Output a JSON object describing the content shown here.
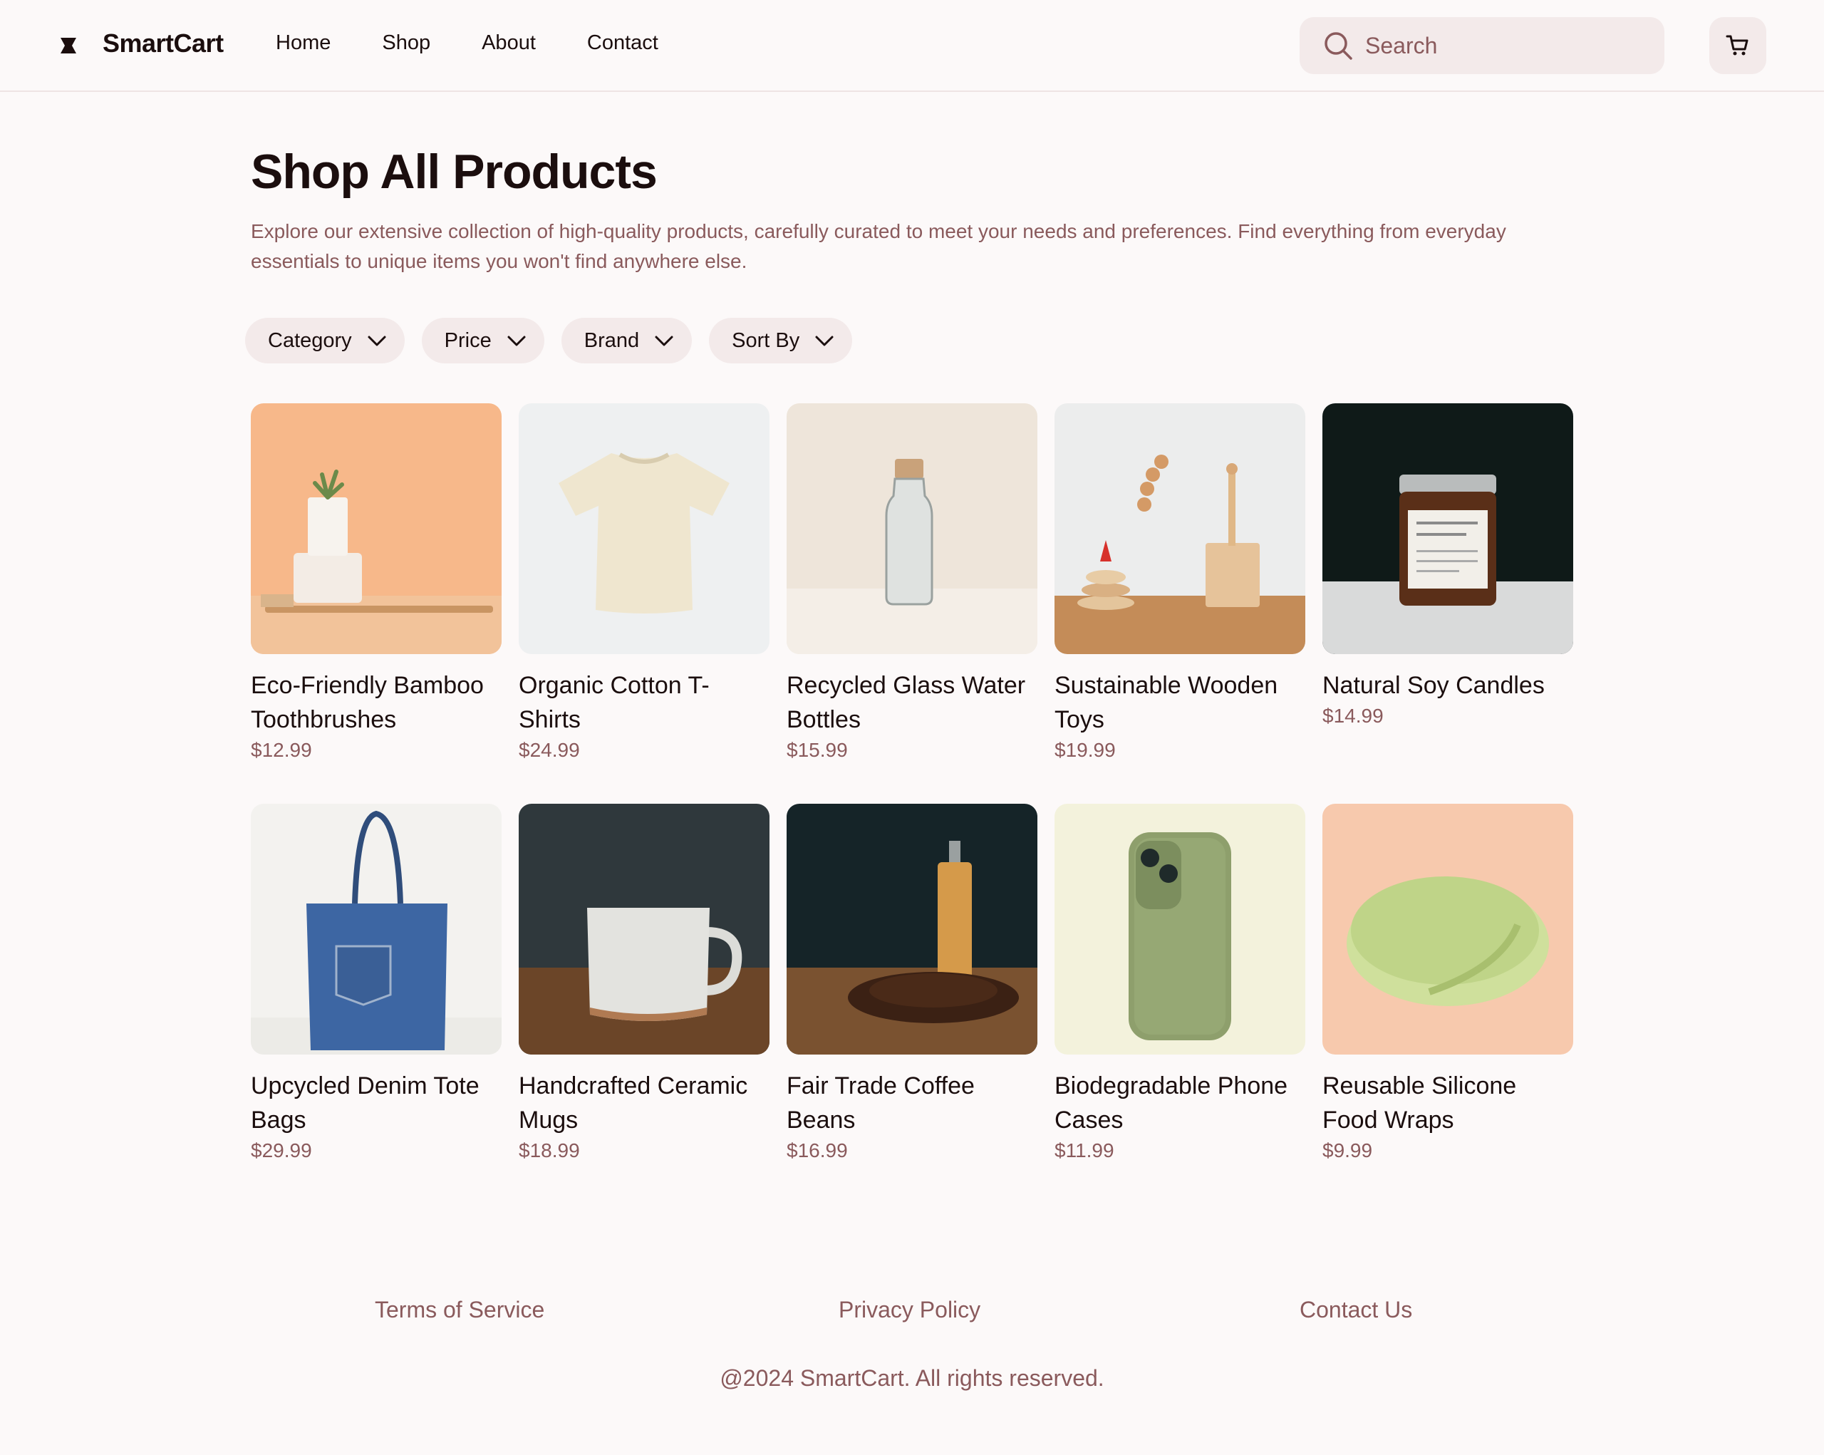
{
  "header": {
    "brand": "SmartCart",
    "nav": [
      "Home",
      "Shop",
      "About",
      "Contact"
    ],
    "search_placeholder": "Search"
  },
  "main": {
    "title": "Shop All Products",
    "description": "Explore our extensive collection of high-quality products, carefully curated to meet your needs and preferences. Find everything from everyday essentials to unique items you won't find anywhere else.",
    "filters": [
      "Category",
      "Price",
      "Brand",
      "Sort By"
    ],
    "products": [
      {
        "name": "Eco-Friendly Bamboo Toothbrushes",
        "price": "$12.99"
      },
      {
        "name": "Organic Cotton T-Shirts",
        "price": "$24.99"
      },
      {
        "name": "Recycled Glass Water Bottles",
        "price": "$15.99"
      },
      {
        "name": "Sustainable Wooden Toys",
        "price": "$19.99"
      },
      {
        "name": "Natural Soy Candles",
        "price": "$14.99"
      },
      {
        "name": "Upcycled Denim Tote Bags",
        "price": "$29.99"
      },
      {
        "name": "Handcrafted Ceramic Mugs",
        "price": "$18.99"
      },
      {
        "name": "Fair Trade Coffee Beans",
        "price": "$16.99"
      },
      {
        "name": "Biodegradable Phone Cases",
        "price": "$11.99"
      },
      {
        "name": "Reusable Silicone Food Wraps",
        "price": "$9.99"
      }
    ]
  },
  "footer": {
    "links": [
      "Terms of Service",
      "Privacy Policy",
      "Contact Us"
    ],
    "copyright": "@2024 SmartCart. All rights reserved."
  },
  "colors": {
    "background": "#fcf9f9",
    "muted_text": "#8a5a5c",
    "chip_background": "#f3eaea",
    "text": "#1b0e0e"
  }
}
